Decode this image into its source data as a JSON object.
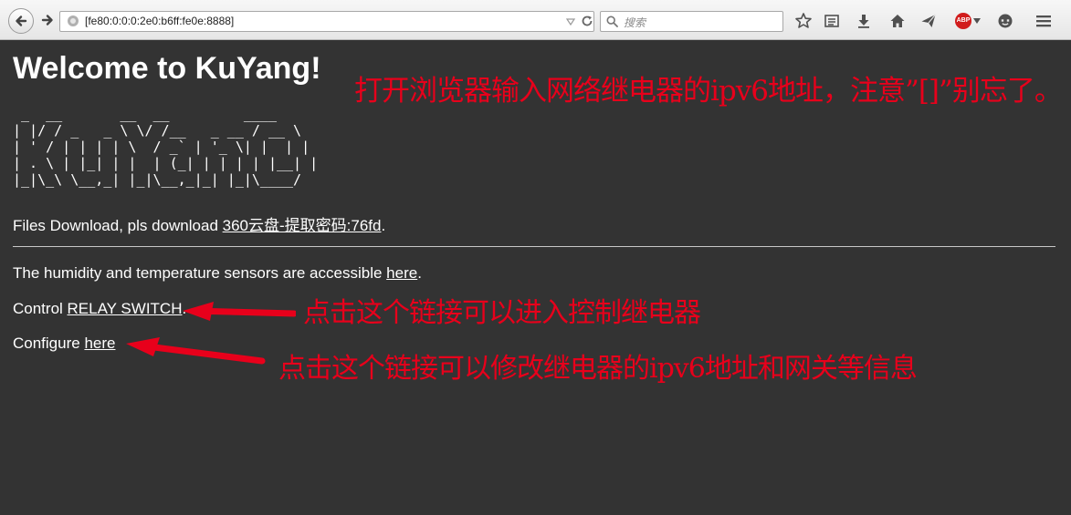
{
  "browser": {
    "url": "[fe80:0:0:0:2e0:b6ff:fe0e:8888]",
    "search_placeholder": "搜索",
    "abp_label": "ABP"
  },
  "page": {
    "title": "Welcome to KuYang!",
    "ascii_art": " _  __       __  __         ____\n| |/ / _   _ \\ \\/ /__   _ __ / __ \\\n| ' / | | | | \\  / _` | '_ \\| |  | |\n| . \\ | |_| | |  | (_| | | | | |__| |\n|_|\\_\\ \\__,_| |_|\\__,_|_| |_|\\____/",
    "downloads": {
      "prefix": "Files Download, pls download ",
      "link": "360云盘-提取密码:76fd",
      "suffix": "."
    },
    "sensors": {
      "prefix": "The humidity and temperature sensors are accessible ",
      "link": "here",
      "suffix": "."
    },
    "control": {
      "prefix": "Control ",
      "link": "RELAY SWITCH",
      "suffix": "."
    },
    "configure": {
      "prefix": "Configure ",
      "link": "here"
    }
  },
  "annotations": {
    "top": "打开浏览器输入网络继电器的ipv6地址，注意”[]”别忘了。",
    "control_hint": "点击这个链接可以进入控制继电器",
    "configure_hint": "点击这个链接可以修改继电器的ipv6地址和网关等信息"
  },
  "colors": {
    "page_background": "#333333",
    "annotation_red": "#e8001b"
  }
}
